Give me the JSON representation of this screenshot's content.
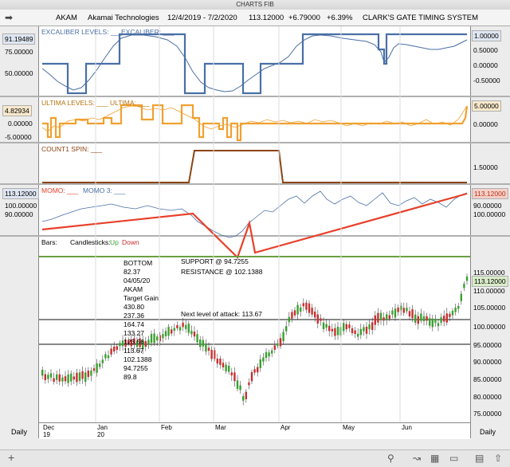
{
  "window_title": "CHARTS FIB",
  "header": {
    "symbol": "AKAM",
    "company": "Akamai Technologies",
    "date_range": "12/4/2019 - 7/2/2020",
    "price": "113.12000",
    "change": "+6.79000",
    "change_pct": "+6.39%",
    "system": "CLARK'S GATE TIMING SYSTEM"
  },
  "panels": {
    "excaliber": {
      "legend1": "EXCALIBER LEVELS: ___",
      "legend2": "EXCALIBER: ___",
      "left_value": "91.19489",
      "right_value": "1.00000",
      "left_ticks": [
        "75.00000",
        "50.00000"
      ],
      "right_ticks": [
        "0.50000",
        "0.00000",
        "-0.50000"
      ]
    },
    "ultima": {
      "legend1": "ULTIMA LEVELS: ___",
      "legend2": "ULTIMA: ___",
      "left_value": "4.82934",
      "right_value": "5.00000",
      "left_ticks": [
        "0.00000",
        "-5.00000"
      ],
      "right_ticks": [
        "0.00000"
      ]
    },
    "count1": {
      "legend": "COUNT1 SPIN: ___",
      "right_ticks": [
        "1.50000"
      ]
    },
    "momo": {
      "legend1": "MOMO: ___",
      "legend2": "MOMO 3: ___",
      "left_value": "113.12000",
      "right_value": "113.12000",
      "left_ticks": [
        "100.00000",
        "90.00000"
      ],
      "right_ticks": [
        "100.00000",
        "90.00000"
      ]
    },
    "price": {
      "legend_bars": "Bars:",
      "legend_candles": "Candlesticks:",
      "legend_up": "Up",
      "legend_down": "Down",
      "right_value": "113.12000",
      "right_ticks": [
        "115.00000",
        "110.00000",
        "105.00000",
        "100.00000",
        "95.00000",
        "90.00000",
        "85.00000",
        "80.00000",
        "75.00000"
      ],
      "support": "SUPPORT @ 94.7255",
      "resistance": "RESISTANCE @ 102.1388",
      "next_attack": "Next level of attack: 113.67",
      "info_lines": [
        "BOTTOM",
        "82.37",
        "04/05/20",
        "AKAM",
        "Target Gain",
        "430.80",
        "237.36",
        "164.74",
        "133.27",
        "123.56",
        "113.67",
        "102.1388",
        "94.7255",
        "89.8"
      ]
    }
  },
  "x_axis": {
    "labels": [
      {
        "text": "Dec",
        "sub": "19"
      },
      {
        "text": "Jan",
        "sub": "20"
      },
      {
        "text": "Feb",
        "sub": ""
      },
      {
        "text": "Mar",
        "sub": ""
      },
      {
        "text": "Apr",
        "sub": ""
      },
      {
        "text": "May",
        "sub": ""
      },
      {
        "text": "Jun",
        "sub": ""
      }
    ],
    "period_left": "Daily",
    "period_right": "Daily"
  },
  "toolbar": {
    "add_label": "+"
  },
  "colors": {
    "blue": "#4a6fa5",
    "orange": "#f0a030",
    "brown": "#8b4513",
    "red": "#e8402a",
    "green": "#3aa030",
    "candle_down": "#c83030"
  }
}
